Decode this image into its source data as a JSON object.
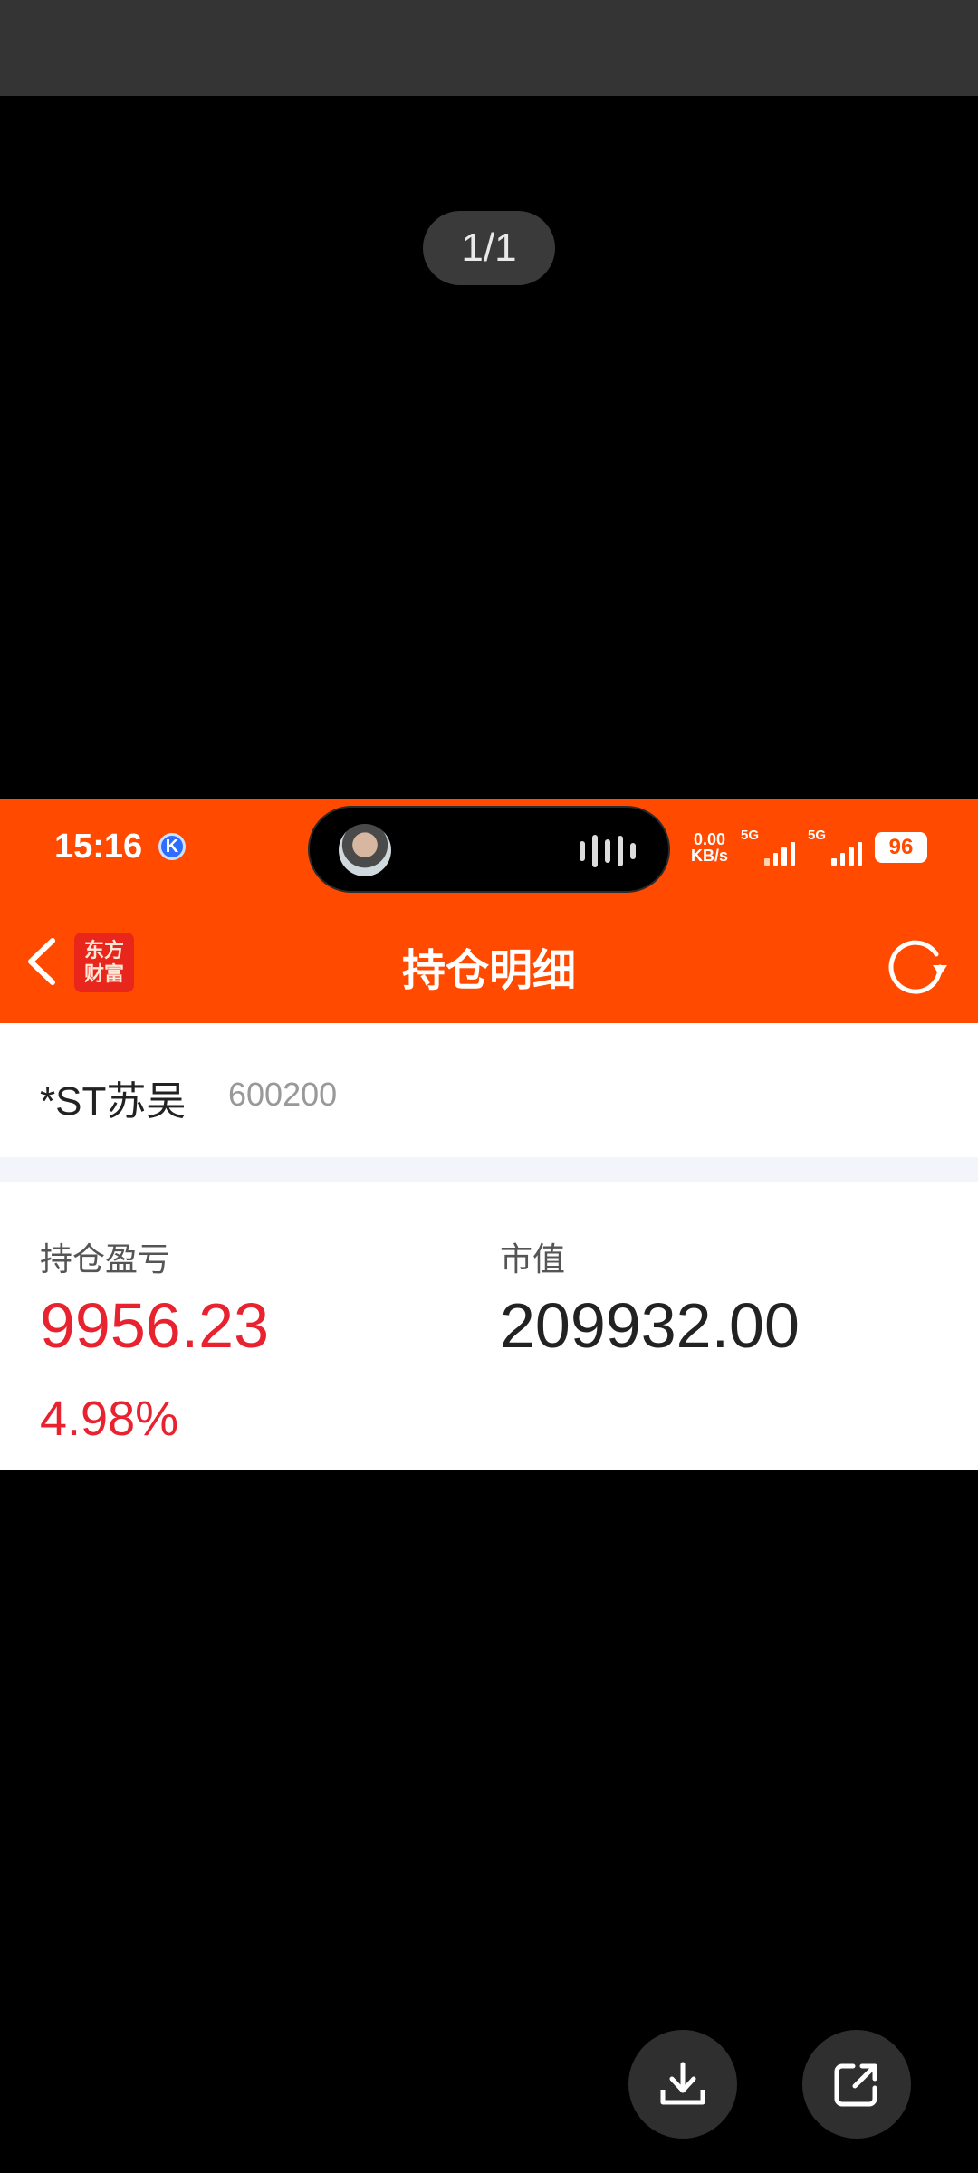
{
  "viewer": {
    "page_indicator": "1/1"
  },
  "status_bar": {
    "time": "15:16",
    "k_badge": "K",
    "net_speed_value": "0.00",
    "net_speed_unit": "KB/s",
    "signal1_label": "5G",
    "signal2_label": "5G",
    "battery": "96"
  },
  "header": {
    "logo_line1": "东方",
    "logo_line2": "财富",
    "title": "持仓明细"
  },
  "stock": {
    "name": "*ST苏吴",
    "code": "600200"
  },
  "metrics": {
    "pnl_label": "持仓盈亏",
    "pnl_value": "9956.23",
    "pnl_percent": "4.98%",
    "market_value_label": "市值",
    "market_value": "209932.00"
  },
  "colors": {
    "brand_orange": "#ff4a00",
    "loss_gain_red": "#e8222e"
  },
  "icons": {
    "back": "chevron-left-icon",
    "refresh": "refresh-icon",
    "download": "download-icon",
    "share": "share-icon"
  }
}
